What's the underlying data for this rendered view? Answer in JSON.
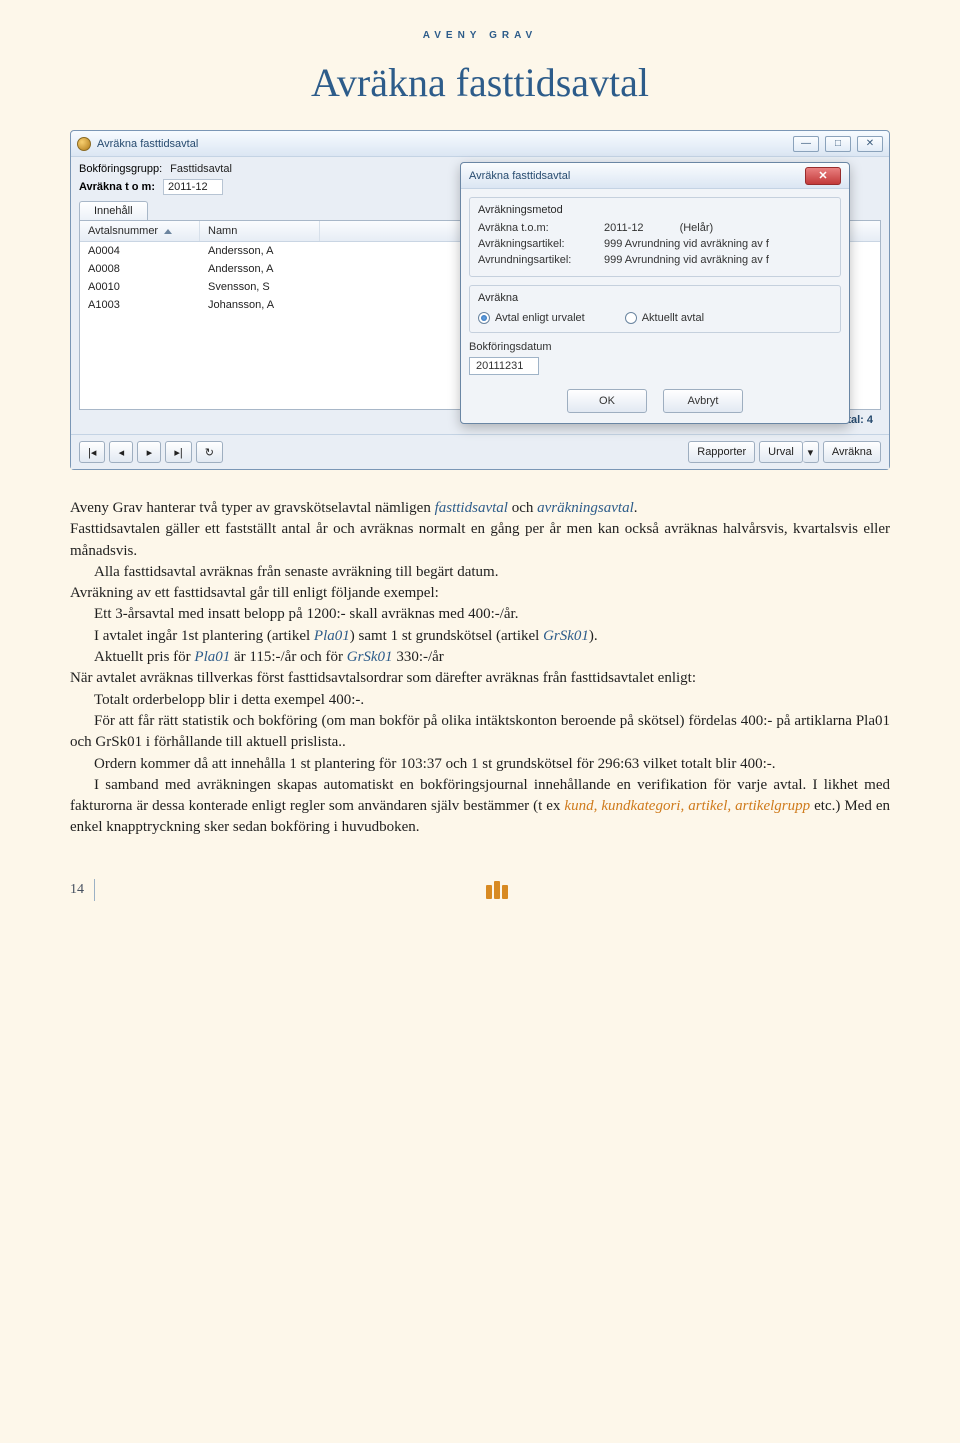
{
  "header_small": "AVENY GRAV",
  "page_title": "Avräkna fasttidsavtal",
  "page_number": "14",
  "window": {
    "title": "Avräkna fasttidsavtal",
    "bookgroup_label": "Bokföringsgrupp:",
    "bookgroup_value": "Fasttidsavtal",
    "avrakna_label": "Avräkna t o m:",
    "avrakna_value": "2011-12",
    "tab": "Innehåll",
    "col_avtal": "Avtalsnummer",
    "col_namn": "Namn",
    "rows": [
      {
        "avtal": "A0004",
        "namn": "Andersson, A"
      },
      {
        "avtal": "A0008",
        "namn": "Andersson, A"
      },
      {
        "avtal": "A0010",
        "namn": "Svensson, S"
      },
      {
        "avtal": "A1003",
        "namn": "Johansson, A"
      }
    ],
    "antal_label": "Antal: 4",
    "btn_rapporter": "Rapporter",
    "btn_urval": "Urval",
    "btn_avrakna": "Avräkna"
  },
  "dialog": {
    "title": "Avräkna fasttidsavtal",
    "g1_title": "Avräkningsmetod",
    "r1_lbl": "Avräkna t.o.m:",
    "r1_val": "2011-12",
    "r1_extra": "(Helår)",
    "r2_lbl": "Avräkningsartikel:",
    "r2_val": "999 Avrundning vid avräkning av f",
    "r3_lbl": "Avrundningsartikel:",
    "r3_val": "999 Avrundning vid avräkning av f",
    "g2_title": "Avräkna",
    "radio1": "Avtal enligt urvalet",
    "radio2": "Aktuellt avtal",
    "bokf_lbl": "Bokföringsdatum",
    "bokf_val": "20111231",
    "ok": "OK",
    "cancel": "Avbryt"
  },
  "body": {
    "p1a": "Aveny Grav hanterar två typer av gravskötselavtal nämligen ",
    "p1b": "fasttidsavtal",
    "p1c": " och ",
    "p1d": "avräkningsavtal",
    "p1e": ".",
    "p2": "Fasttidsavtalen gäller ett fastställt antal år och avräknas normalt en gång per år men kan också avräknas halvårsvis, kvartalsvis eller månadsvis.",
    "p3": "Alla fasttidsavtal avräknas från senaste avräkning till begärt datum.",
    "p4": "Avräkning av ett fasttidsavtal går till enligt följande exempel:",
    "p5": "Ett 3-årsavtal med insatt belopp på 1200:- skall avräknas med 400:-/år.",
    "p6a": "I avtalet ingår 1st plantering (artikel ",
    "p6b": "Pla01",
    "p6c": ") samt 1 st grundskötsel (artikel ",
    "p6d": "GrSk01",
    "p6e": ").",
    "p7a": "Aktuellt pris för ",
    "p7b": "Pla01",
    "p7c": " är 115:-/år och för ",
    "p7d": "GrSk01",
    "p7e": " 330:-/år",
    "p8": "När avtalet avräknas tillverkas först fasttidsavtalsordrar som därefter avräknas från fasttidsavtalet enligt:",
    "p9": "Totalt orderbelopp blir i detta exempel 400:-.",
    "p10": "För att får rätt statistik och bokföring (om man bokför på olika intäktskonton beroende på skötsel) fördelas 400:- på artiklarna Pla01 och GrSk01 i förhållande till aktuell prislista..",
    "p11": "Ordern kommer då att innehålla 1 st plantering för 103:37 och 1 st grundskötsel för 296:63 vilket totalt blir 400:-.",
    "p12a": "I samband med avräkningen skapas automatiskt en bokföringsjournal innehållande en verifikation för varje avtal. I likhet med fakturorna är dessa konterade enligt regler som användaren själv bestämmer (t ex ",
    "p12b": "kund, kundkategori, artikel, artikelgrupp",
    "p12c": " etc.) Med en enkel knapptryckning sker sedan bokföring i huvudboken."
  }
}
